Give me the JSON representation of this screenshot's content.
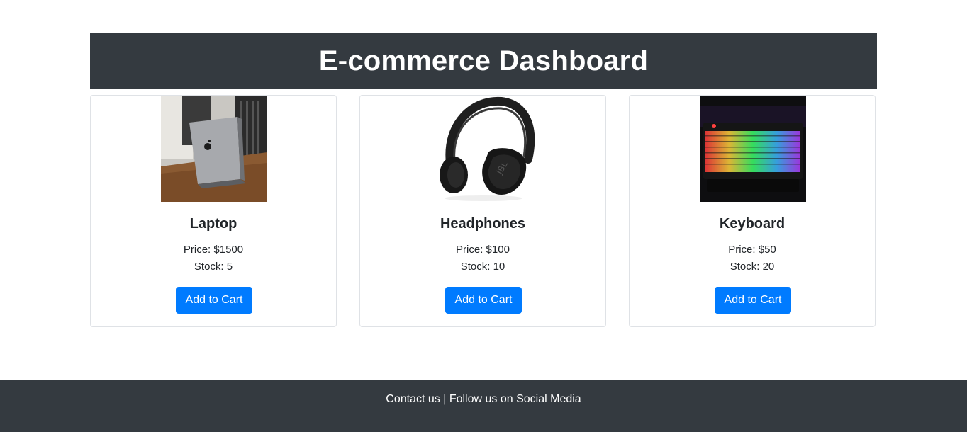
{
  "header": {
    "title": "E-commerce Dashboard"
  },
  "products": [
    {
      "name": "Laptop",
      "price_text": "Price: $1500",
      "stock_text": "Stock: 5",
      "button_label": "Add to Cart",
      "image": "laptop-image"
    },
    {
      "name": "Headphones",
      "price_text": "Price: $100",
      "stock_text": "Stock: 10",
      "button_label": "Add to Cart",
      "image": "headphones-image"
    },
    {
      "name": "Keyboard",
      "price_text": "Price: $50",
      "stock_text": "Stock: 20",
      "button_label": "Add to Cart",
      "image": "keyboard-image"
    }
  ],
  "footer": {
    "text": "Contact us | Follow us on Social Media"
  },
  "colors": {
    "header_bg": "#343a40",
    "footer_bg": "#343a40",
    "button_bg": "#007bff",
    "card_border": "#dfe2e6"
  }
}
